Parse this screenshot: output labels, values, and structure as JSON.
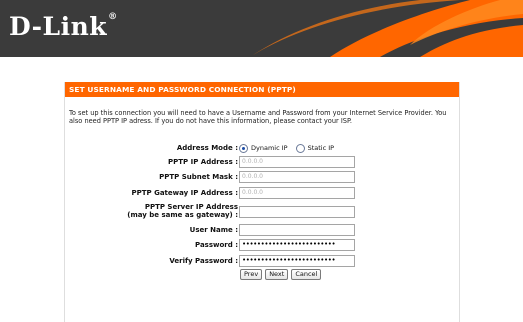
{
  "header": {
    "logo_text": "D-Link",
    "logo_mark": "®",
    "brand_color": "#ff6600",
    "bar_color": "#3b3b3b"
  },
  "panel": {
    "title": "SET USERNAME AND PASSWORD CONNECTION (PPTP)",
    "intro": "To set up this connection you will need to have a Username and Password from your Internet Service Provider. You also need PPTP IP adress. If you do not have this information, please contact your ISP.",
    "address_mode": {
      "label": "Address Mode :",
      "options": [
        "Dynamic IP",
        "Static IP"
      ],
      "selected": "Dynamic IP"
    },
    "fields": [
      {
        "label": "PPTP IP Address :",
        "value": "0.0.0.0"
      },
      {
        "label": "PPTP Subnet Mask :",
        "value": "0.0.0.0"
      },
      {
        "label": "PPTP Gateway IP Address :",
        "value": "0.0.0.0"
      },
      {
        "label_line1": "PPTP Server IP Address",
        "label_line2": "(may be same as gateway) :",
        "value": ""
      },
      {
        "label": "User Name :",
        "value": ""
      },
      {
        "label": "Password :",
        "value": "•••••••••••••••••••••••••"
      },
      {
        "label": "Verify Password :",
        "value": "•••••••••••••••••••••••••"
      }
    ],
    "buttons": {
      "prev": "Prev",
      "next": "Next",
      "cancel": "Cancel"
    }
  }
}
